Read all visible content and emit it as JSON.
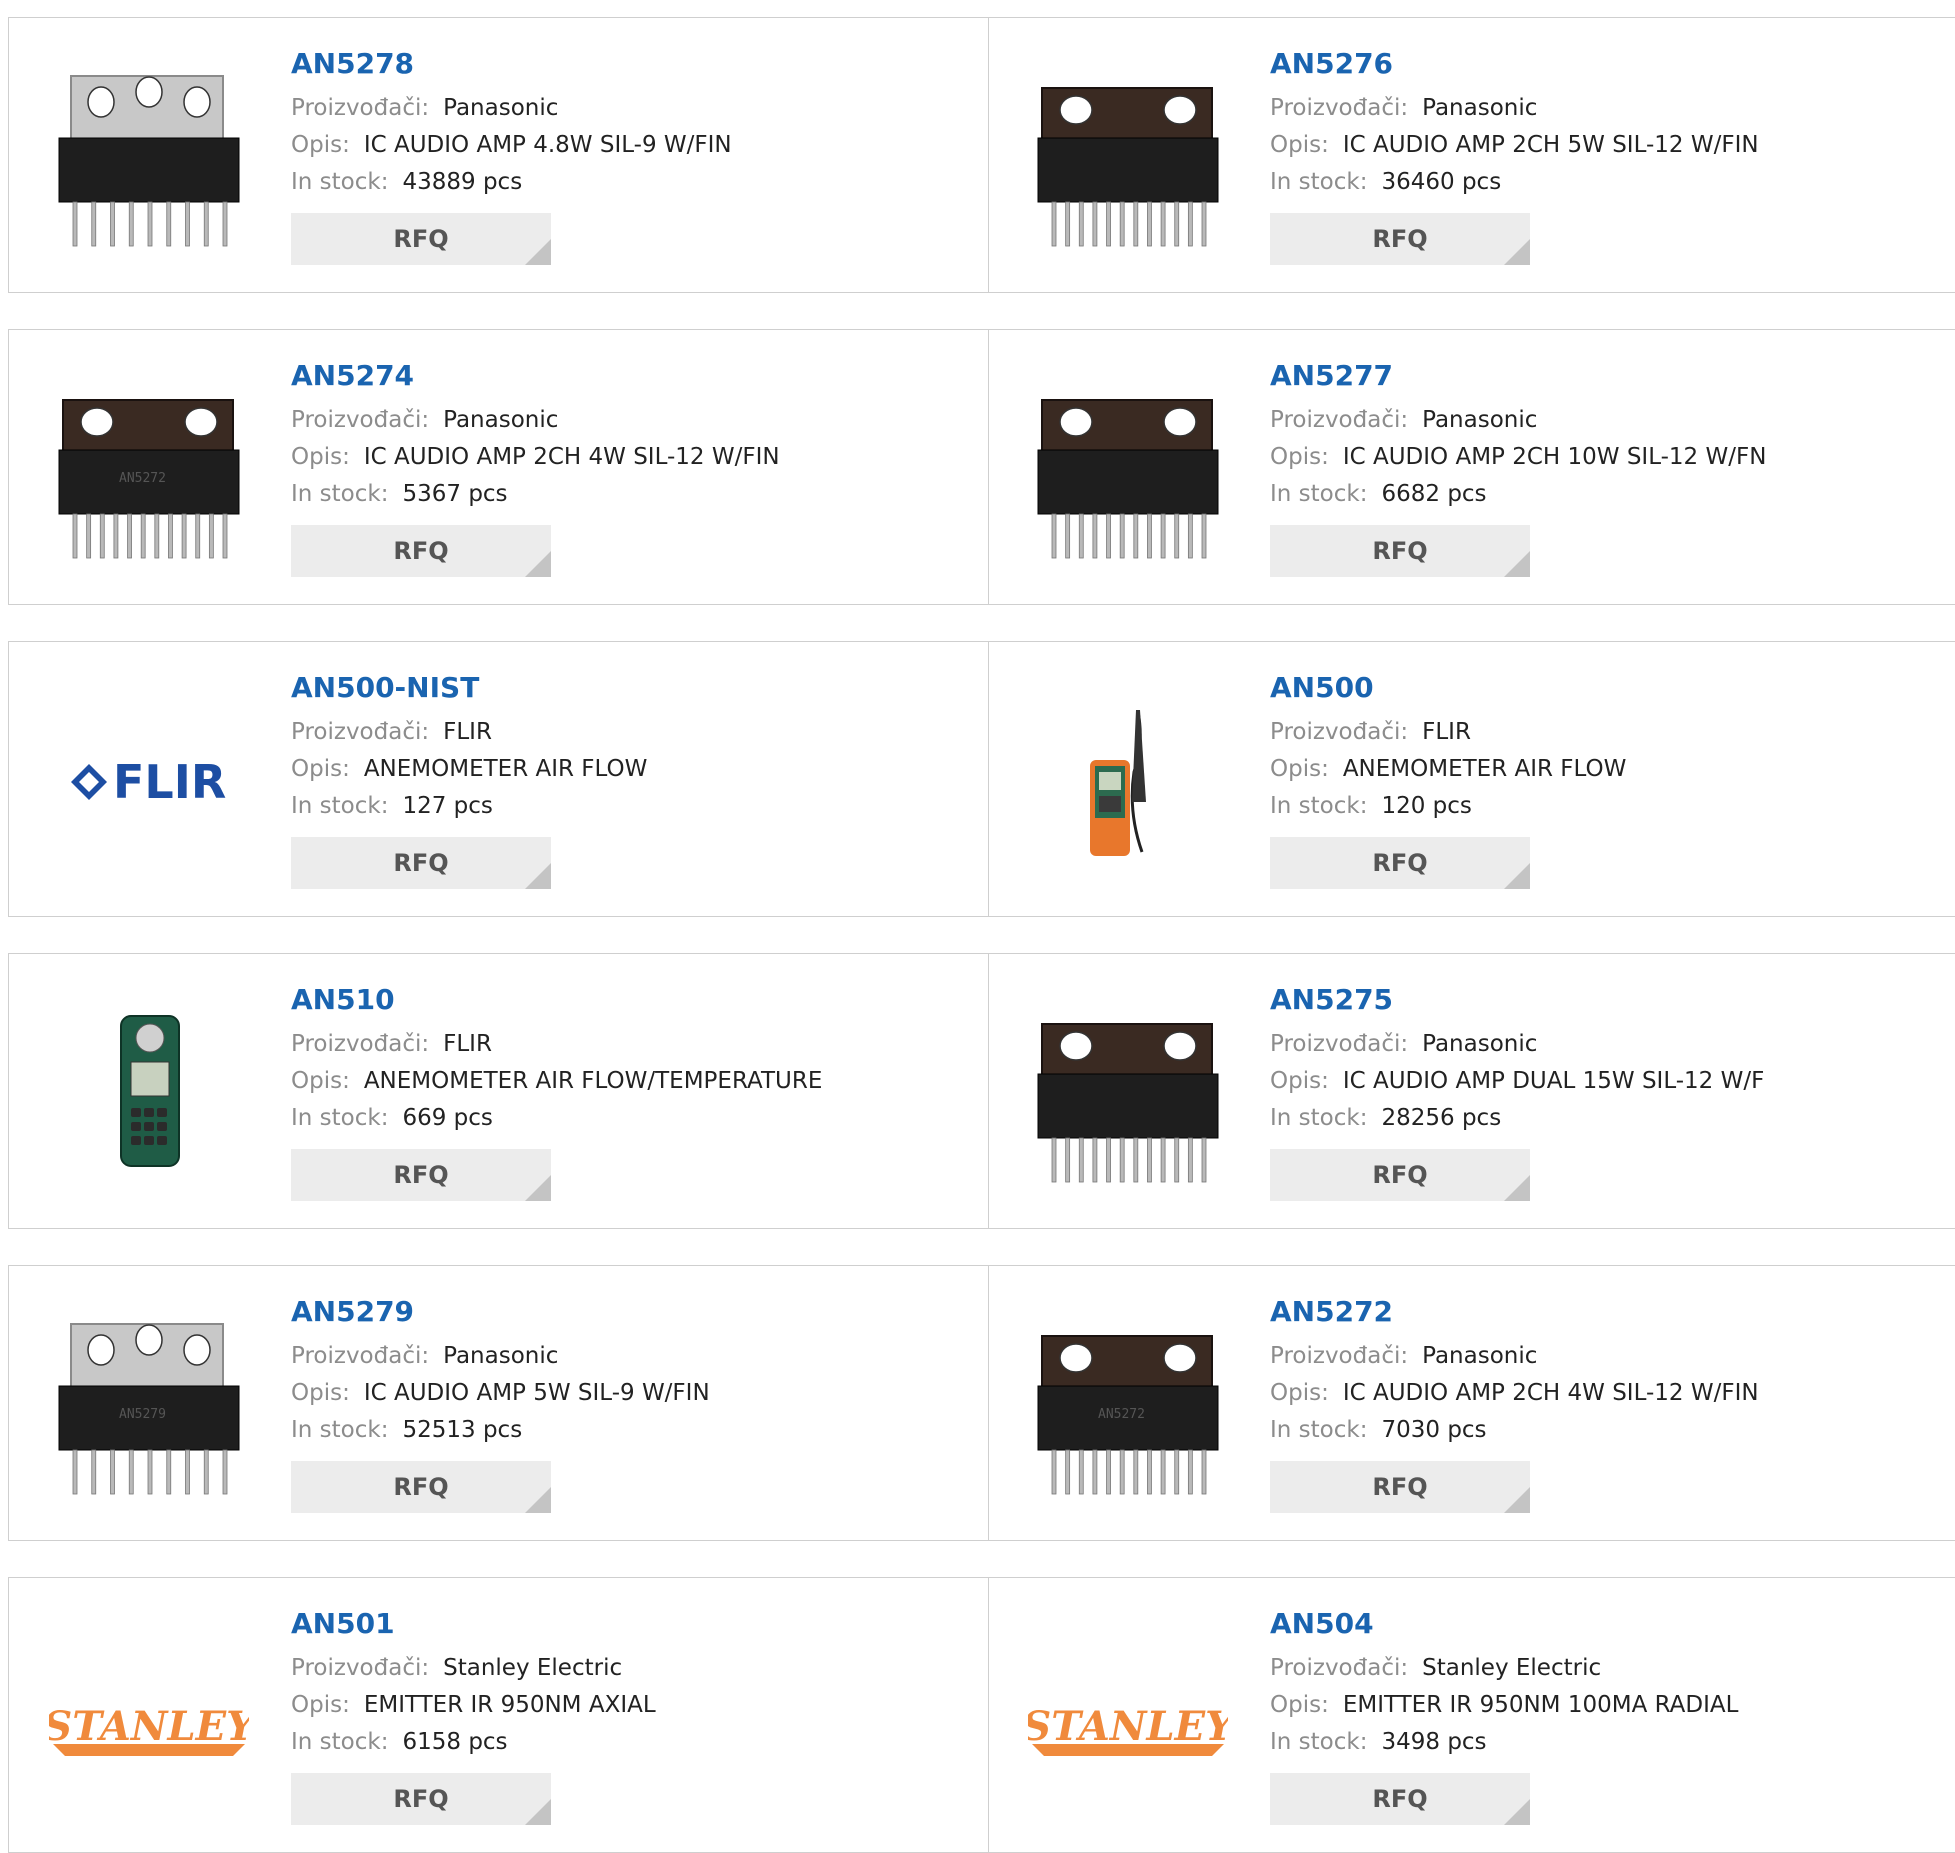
{
  "labels": {
    "manufacturer": "Proizvođači:",
    "description": "Opis:",
    "stock": "In stock:",
    "rfq": "RFQ"
  },
  "products": [
    {
      "pn": "AN5278",
      "manufacturer": "Panasonic",
      "description": "IC AUDIO AMP 4.8W SIL-9 W/FIN",
      "stock": "43889 pcs",
      "image": "ic-chip-silver-fin",
      "pins": 9
    },
    {
      "pn": "AN5276",
      "manufacturer": "Panasonic",
      "description": "IC AUDIO AMP 2CH 5W SIL-12 W/FIN",
      "stock": "36460 pcs",
      "image": "ic-chip-dark-fin",
      "pins": 12
    },
    {
      "pn": "AN5274",
      "manufacturer": "Panasonic",
      "description": "IC AUDIO AMP 2CH 4W SIL-12 W/FIN",
      "stock": "5367 pcs",
      "image": "ic-chip-dark-fin",
      "pins": 12,
      "marking": "AN5272"
    },
    {
      "pn": "AN5277",
      "manufacturer": "Panasonic",
      "description": "IC AUDIO AMP 2CH 10W SIL-12 W/FN",
      "stock": "6682 pcs",
      "image": "ic-chip-dark-fin",
      "pins": 12
    },
    {
      "pn": "AN500-NIST",
      "manufacturer": "FLIR",
      "description": "ANEMOMETER AIR FLOW",
      "stock": "127 pcs",
      "image": "flir-logo",
      "logo_text": "FLIR"
    },
    {
      "pn": "AN500",
      "manufacturer": "FLIR",
      "description": "ANEMOMETER AIR FLOW",
      "stock": "120 pcs",
      "image": "anemometer-probe"
    },
    {
      "pn": "AN510",
      "manufacturer": "FLIR",
      "description": "ANEMOMETER AIR FLOW/TEMPERATURE",
      "stock": "669 pcs",
      "image": "anemometer-handheld"
    },
    {
      "pn": "AN5275",
      "manufacturer": "Panasonic",
      "description": "IC AUDIO AMP DUAL 15W SIL-12 W/F",
      "stock": "28256 pcs",
      "image": "ic-chip-dark-fin",
      "pins": 12
    },
    {
      "pn": "AN5279",
      "manufacturer": "Panasonic",
      "description": "IC AUDIO AMP 5W SIL-9 W/FIN",
      "stock": "52513 pcs",
      "image": "ic-chip-silver-fin",
      "pins": 9,
      "marking": "AN5279"
    },
    {
      "pn": "AN5272",
      "manufacturer": "Panasonic",
      "description": "IC AUDIO AMP 2CH 4W SIL-12 W/FIN",
      "stock": "7030 pcs",
      "image": "ic-chip-dark-fin",
      "pins": 12,
      "marking": "AN5272"
    },
    {
      "pn": "AN501",
      "manufacturer": "Stanley Electric",
      "description": "EMITTER IR 950NM AXIAL",
      "stock": "6158 pcs",
      "image": "stanley-logo",
      "logo_text": "STANLEY"
    },
    {
      "pn": "AN504",
      "manufacturer": "Stanley Electric",
      "description": "EMITTER IR 950NM 100MA RADIAL",
      "stock": "3498 pcs",
      "image": "stanley-logo",
      "logo_text": "STANLEY"
    }
  ],
  "colors": {
    "link": "#1a64b0",
    "label": "#8c8c8c",
    "rfq_bg": "#ececec",
    "flir_blue": "#1d4ea3",
    "stanley_orange": "#f08a3c"
  }
}
